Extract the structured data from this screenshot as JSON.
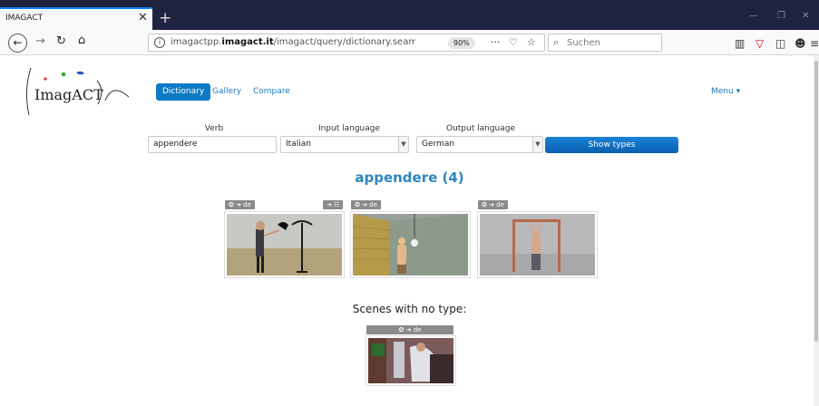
{
  "browser": {
    "tab_title": "IMAGACT",
    "tab_close": "✕",
    "new_tab": "+",
    "url_prefix": "imagactpp.",
    "url_domain": "imagact.it",
    "url_path": "/imagact/query/dictionary.seam;jsessionid=",
    "zoom": "90%",
    "search_placeholder": "Suchen"
  },
  "nav": {
    "dictionary": "Dictionary",
    "gallery": "Gallery",
    "compare": "Compare",
    "menu": "Menu ▾"
  },
  "form": {
    "verb_label": "Verb",
    "verb_value": "appendere",
    "input_language_label": "Input language",
    "input_language_value": "Italian",
    "output_language_label": "Output language",
    "output_language_value": "German",
    "show_types": "Show types"
  },
  "results": {
    "title": "appendere (4)",
    "types": [
      {
        "tag": "❂ ➔ de",
        "tag_list": "➔ ☷"
      },
      {
        "tag": "❂ ➔ de"
      },
      {
        "tag": "❂ ➔ de"
      }
    ],
    "scenes_heading": "Scenes with no type:",
    "scene_tag": "❂ ➔ de"
  },
  "colors": {
    "accent": "#0e7ac4",
    "link": "#1b7bbd",
    "title": "#2d86bf",
    "tab_bar": "#202340"
  },
  "icons": [
    "back-icon",
    "forward-icon",
    "reload-icon",
    "home-icon",
    "info-icon",
    "more-icon",
    "pocket-icon",
    "bookmark-star-icon",
    "search-icon",
    "library-icon",
    "shield-icon",
    "sidebar-icon",
    "avatar-icon",
    "hamburger-icon"
  ]
}
